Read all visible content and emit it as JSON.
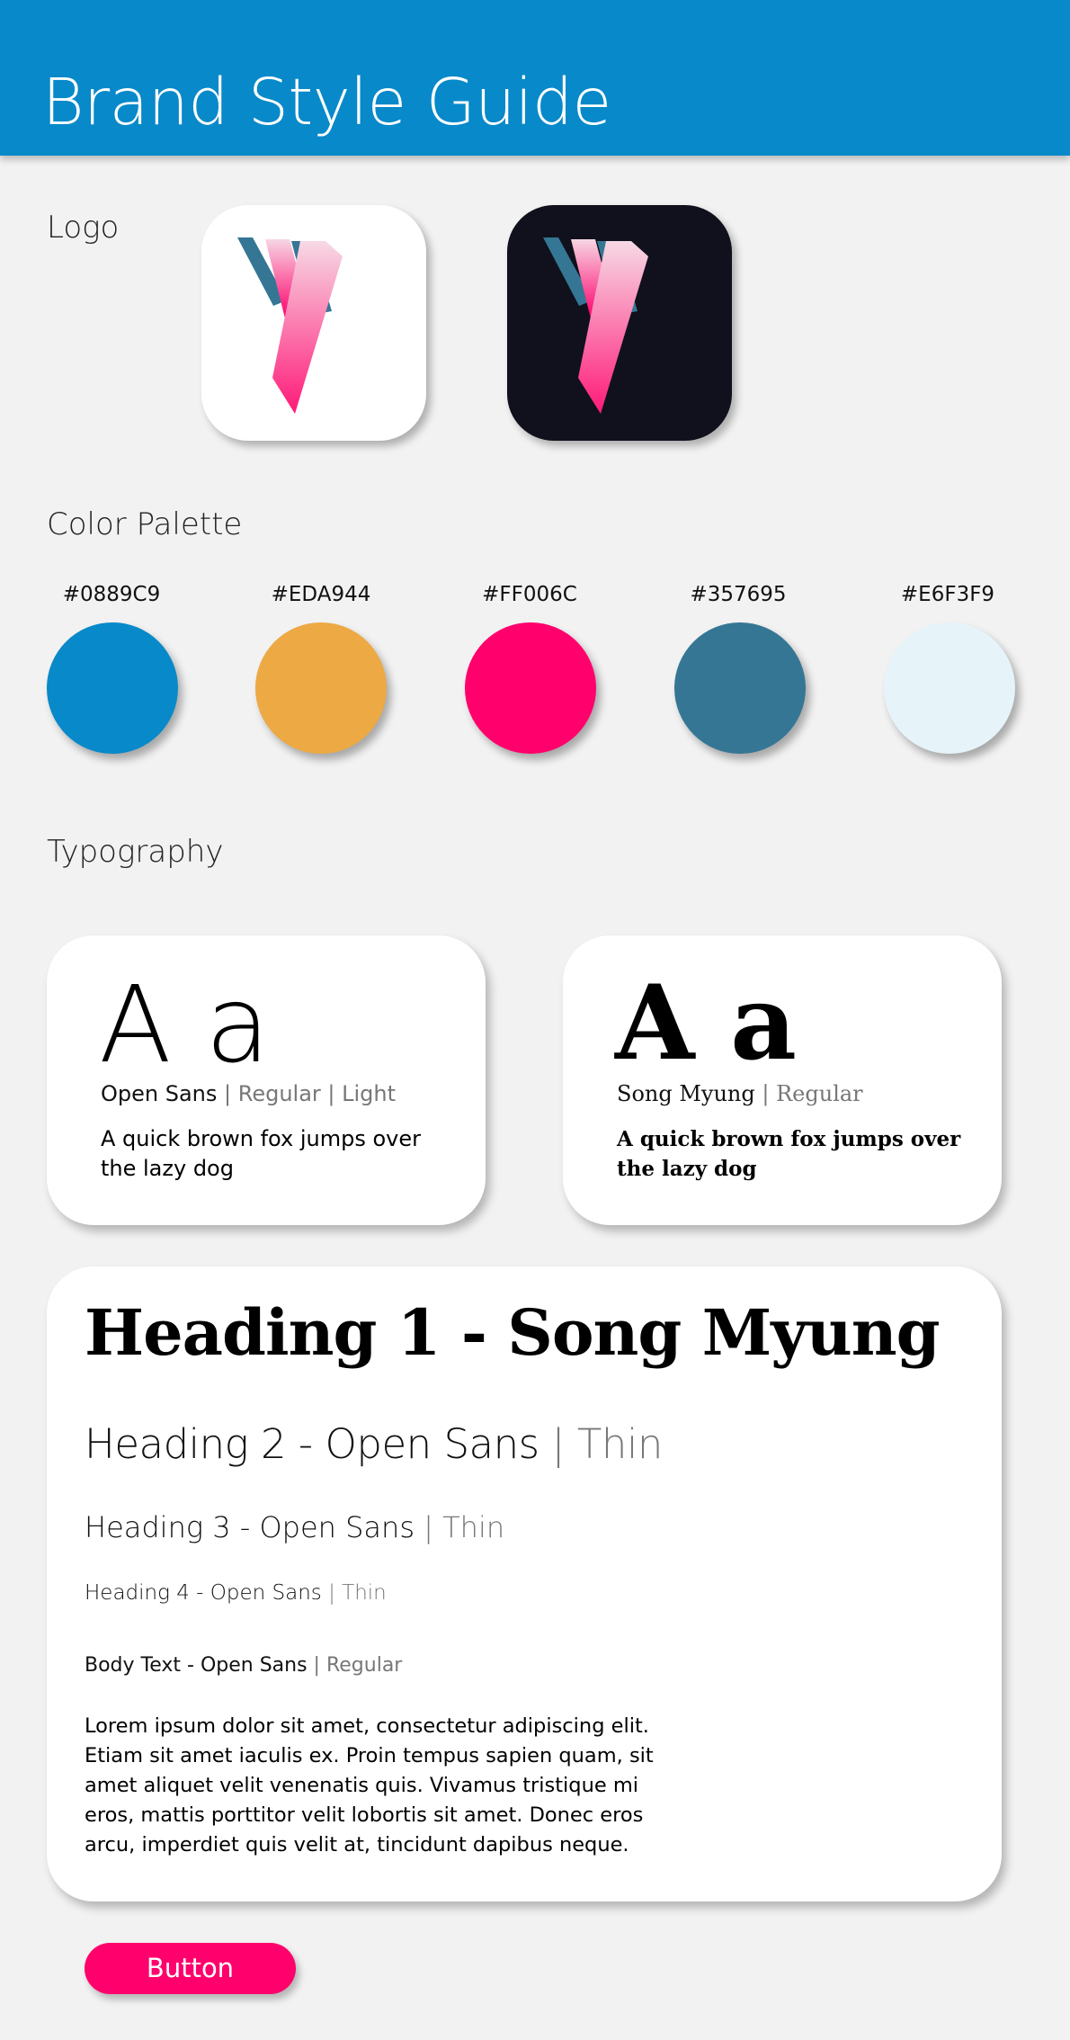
{
  "header": {
    "title": "Brand Style Guide",
    "background": "#0889C9"
  },
  "logo": {
    "section_title": "Logo",
    "variants": [
      {
        "name": "light",
        "background": "#FFFFFF"
      },
      {
        "name": "dark",
        "background": "#10111C"
      }
    ],
    "mark_colors": {
      "blue": "#357695",
      "pink": "#FF006C",
      "pink_light": "#F6D0E0"
    }
  },
  "palette": {
    "section_title": "Color Palette",
    "colors": [
      {
        "hex": "#0889C9"
      },
      {
        "hex": "#EDA944"
      },
      {
        "hex": "#FF006C"
      },
      {
        "hex": "#357695"
      },
      {
        "hex": "#E6F3F9"
      }
    ]
  },
  "typography": {
    "section_title": "Typography",
    "fonts": [
      {
        "sample": "A a",
        "name": "Open Sans",
        "sep1": " | ",
        "weight1": "Regular",
        "sep2": " | ",
        "weight2": "Light",
        "pangram": "A quick brown fox jumps over the lazy dog"
      },
      {
        "sample": "A a",
        "name": "Song Myung",
        "sep1": " | ",
        "weight1": "Regular",
        "pangram": "A quick brown fox jumps over the lazy dog"
      }
    ],
    "headings": {
      "h1": "Heading 1 - Song Myung",
      "h2": "Heading 2 - Open Sans",
      "h2_weight": "Thin",
      "h3": "Heading 3 - Open Sans",
      "h3_weight": "Thin",
      "h4": "Heading 4 - Open Sans",
      "h4_weight": "Thin",
      "body": "Body Text - Open Sans",
      "body_weight": "Regular",
      "separator": " | ",
      "lorem": "Lorem ipsum dolor sit amet, consectetur adipiscing elit. Etiam sit amet iaculis ex. Proin tempus sapien quam, sit amet aliquet velit venenatis quis. Vivamus tristique mi eros, mattis porttitor velit lobortis sit amet. Donec eros arcu, imperdiet quis velit at, tincidunt dapibus neque."
    }
  },
  "button": {
    "label": "Button",
    "color": "#FF006C"
  }
}
